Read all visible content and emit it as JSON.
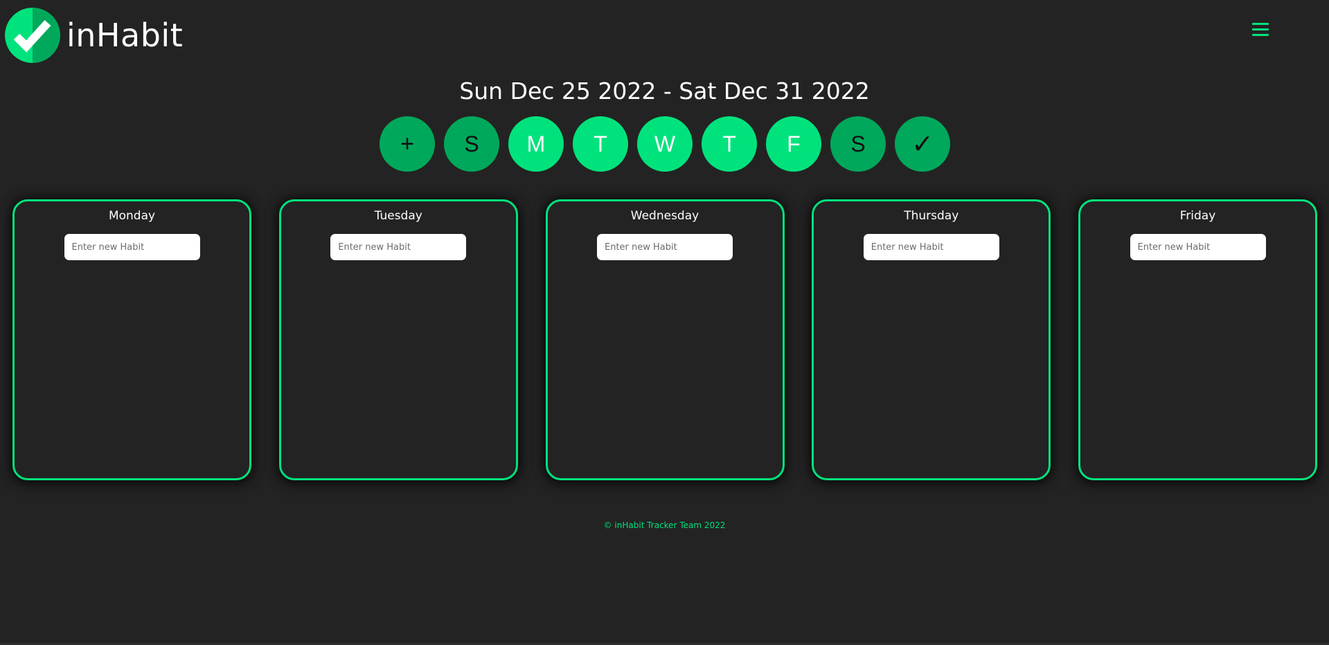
{
  "brand": {
    "name": "inHabit",
    "logo_icon": "checkmark-circle-icon",
    "colors": {
      "accent": "#00e37c",
      "accent_dark": "#00a85b",
      "background": "#232323"
    }
  },
  "header": {
    "menu_icon": "hamburger-menu-icon"
  },
  "week": {
    "title": "Sun Dec 25 2022 - Sat Dec 31 2022"
  },
  "day_bar": [
    {
      "label": "+",
      "kind": "add"
    },
    {
      "label": "S",
      "kind": "day"
    },
    {
      "label": "M",
      "kind": "day"
    },
    {
      "label": "T",
      "kind": "day"
    },
    {
      "label": "W",
      "kind": "day"
    },
    {
      "label": "T",
      "kind": "day"
    },
    {
      "label": "F",
      "kind": "day"
    },
    {
      "label": "S",
      "kind": "day"
    },
    {
      "label": "✓",
      "kind": "complete"
    }
  ],
  "cards": [
    {
      "title": "Monday",
      "input_placeholder": "Enter new Habit"
    },
    {
      "title": "Tuesday",
      "input_placeholder": "Enter new Habit"
    },
    {
      "title": "Wednesday",
      "input_placeholder": "Enter new Habit"
    },
    {
      "title": "Thursday",
      "input_placeholder": "Enter new Habit"
    },
    {
      "title": "Friday",
      "input_placeholder": "Enter new Habit"
    }
  ],
  "footer": {
    "text": "© inHabit Tracker Team 2022"
  }
}
